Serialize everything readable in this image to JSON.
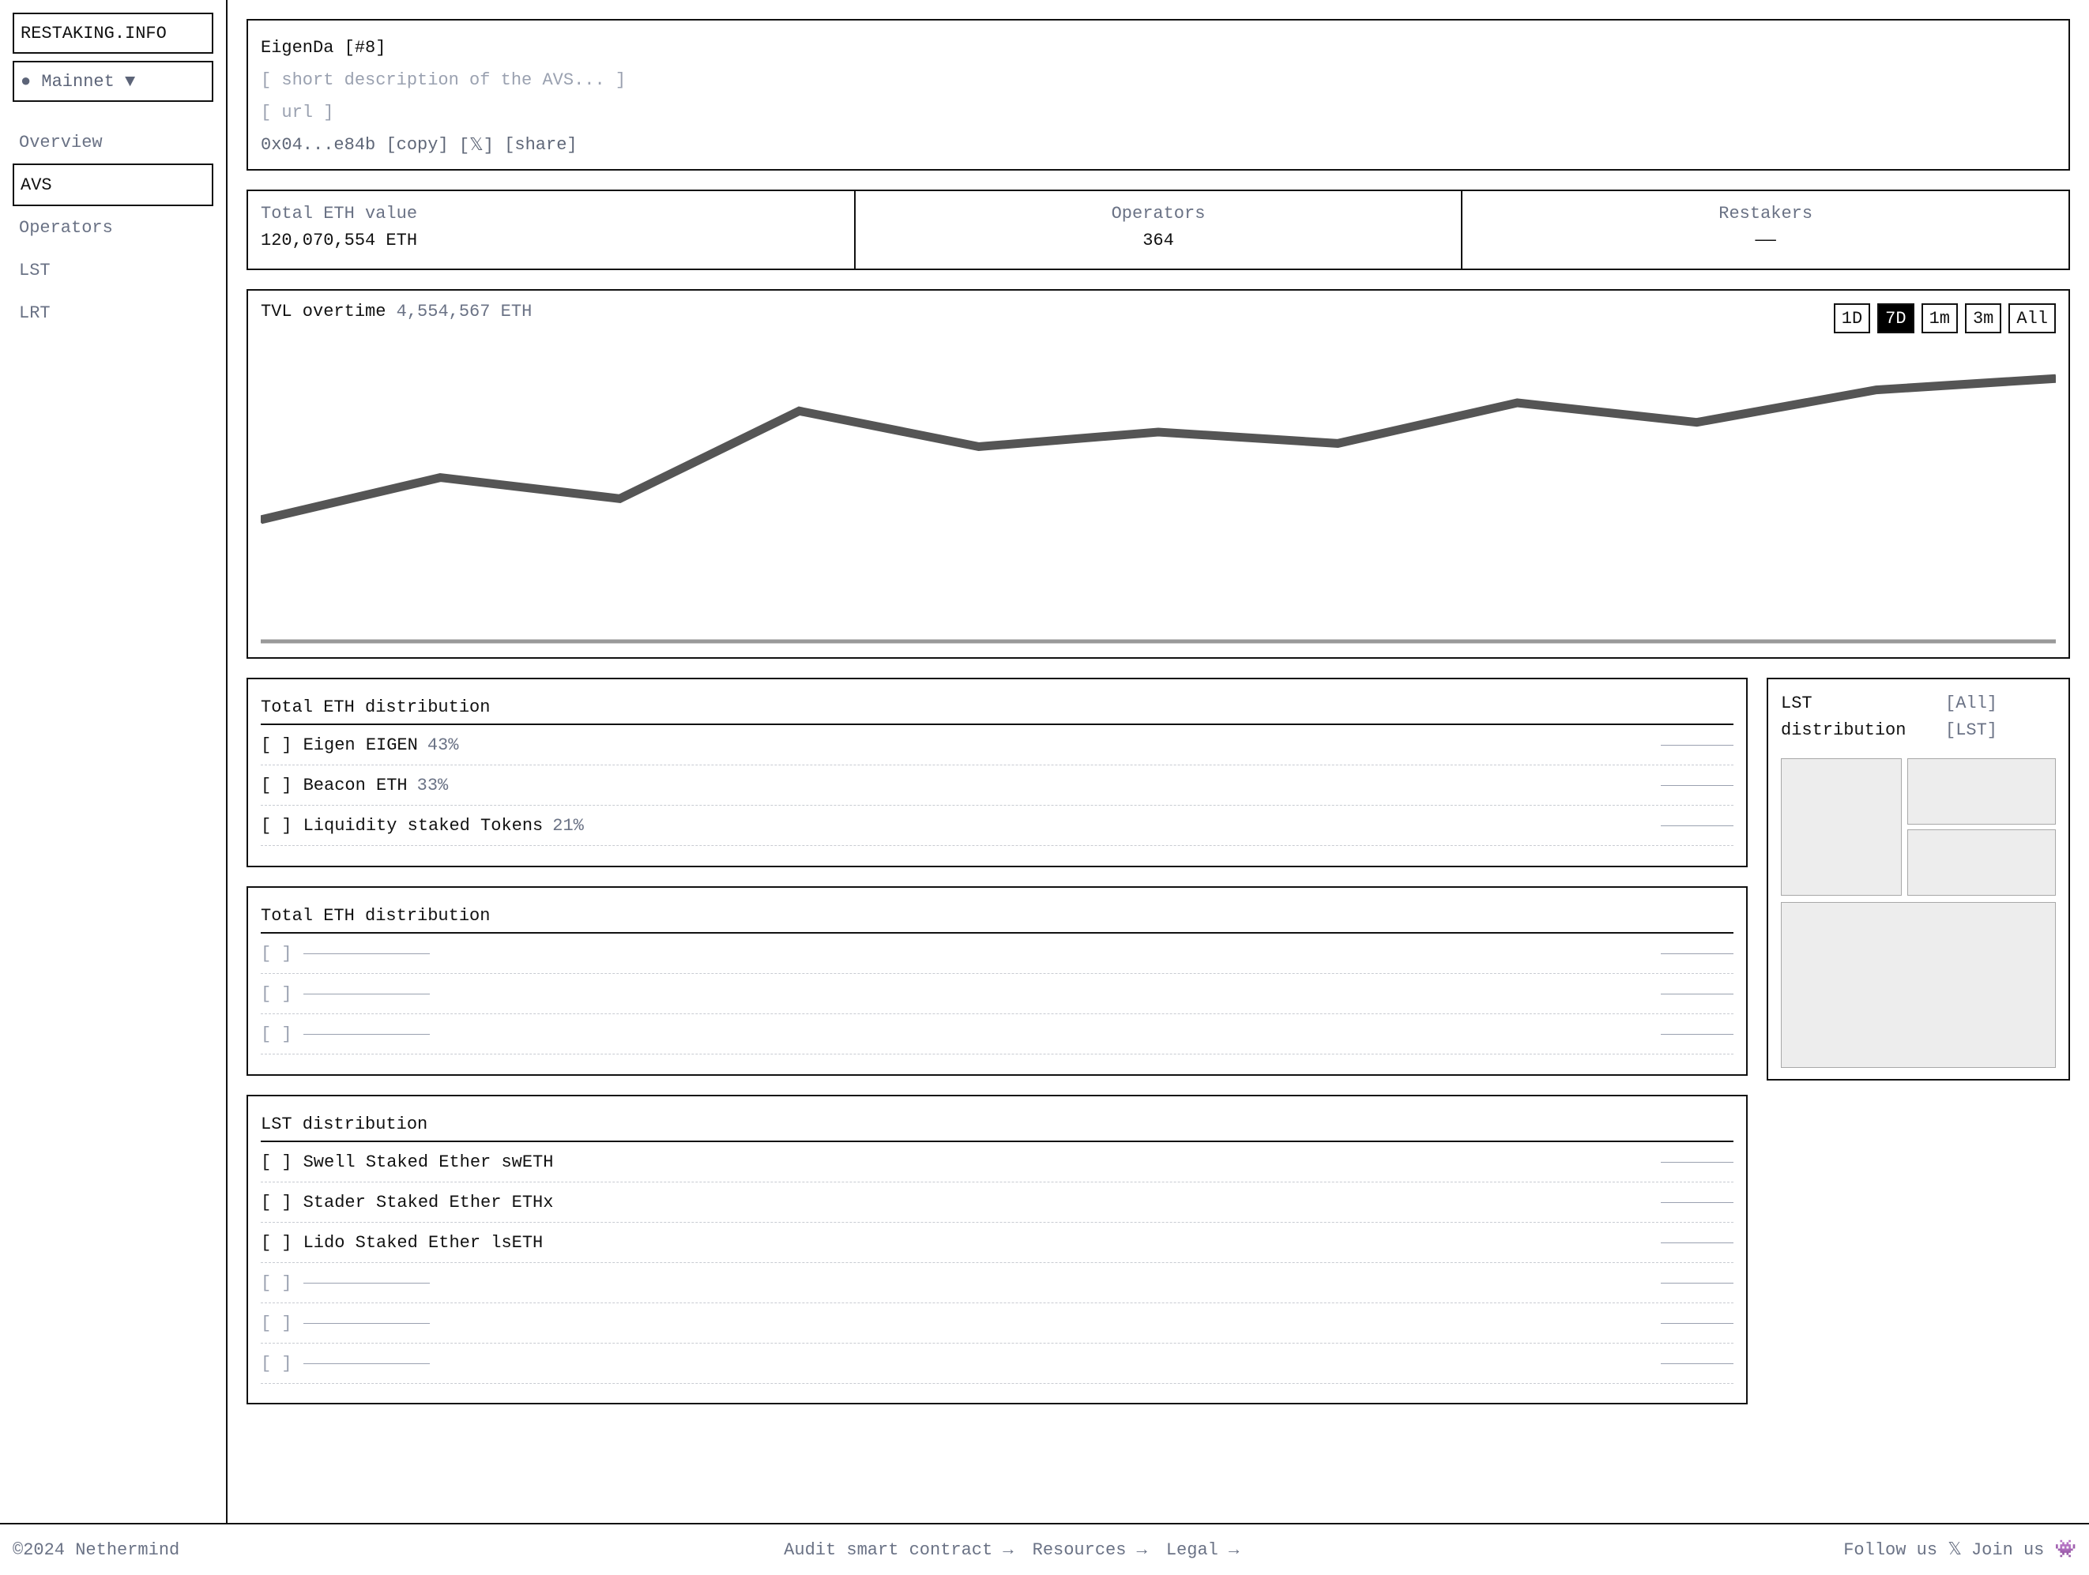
{
  "sidebar": {
    "brand": "RESTAKING.INFO",
    "network": "● Mainnet ▼",
    "nav": [
      "Overview",
      "AVS",
      "Operators",
      "LST",
      "LRT"
    ],
    "active": "AVS"
  },
  "avs": {
    "title": "EigenDa [#8]",
    "description": "[ short description of the AVS... ]",
    "url": "[ url ]",
    "address": "0x04...e84b",
    "copy": "[copy]",
    "x_link": "[𝕏]",
    "share": "[share]"
  },
  "stats": {
    "tvl_label": "Total ETH value",
    "tvl_value": "120,070,554 ETH",
    "operators_label": "Operators",
    "operators_value": "364",
    "restakers_label": "Restakers",
    "restakers_value": "——"
  },
  "tvl_chart": {
    "title": "TVL overtime",
    "value": "4,554,567 ETH",
    "ranges": [
      "1D",
      "7D",
      "1m",
      "3m",
      "All"
    ],
    "active_range": "7D"
  },
  "chart_data": {
    "type": "line",
    "title": "TVL overtime",
    "series": [
      {
        "values": [
          0.22,
          0.48,
          0.35,
          0.89,
          0.67,
          0.76,
          0.69,
          0.94,
          0.82,
          1.02,
          1.09
        ]
      }
    ],
    "ylim": [
      -0.5,
      1.3
    ],
    "grid": false,
    "line_color": "#555555"
  },
  "eth_distribution": {
    "title": "Total ETH distribution",
    "rows": [
      {
        "check": "[ ]",
        "name": "Eigen EIGEN",
        "pct": "43%"
      },
      {
        "check": "[ ]",
        "name": "Beacon ETH",
        "pct": "33%"
      },
      {
        "check": "[ ]",
        "name": "Liquidity staked Tokens",
        "pct": "21%"
      }
    ]
  },
  "eth_distribution_2": {
    "title": "Total ETH distribution",
    "placeholders": [
      "[ ]",
      "[ ]",
      "[ ]"
    ]
  },
  "lst_distribution": {
    "title": "LST distribution",
    "rows": [
      {
        "check": "[ ]",
        "name": "Swell Staked Ether swETH"
      },
      {
        "check": "[ ]",
        "name": "Stader Staked Ether ETHx"
      },
      {
        "check": "[ ]",
        "name": "Lido Staked Ether lsETH"
      }
    ],
    "placeholders": [
      "[ ]",
      "[ ]",
      "[ ]"
    ]
  },
  "lst_panel": {
    "title_line1": "LST",
    "title_line2": "distribution",
    "opt_all": "[All]",
    "opt_lst": "[LST]"
  },
  "footer": {
    "copyright": "©2024 Nethermind",
    "links": [
      "Audit smart contract →",
      "Resources →",
      "Legal →"
    ],
    "follow": "Follow us 𝕏",
    "join": "Join us 👾"
  }
}
